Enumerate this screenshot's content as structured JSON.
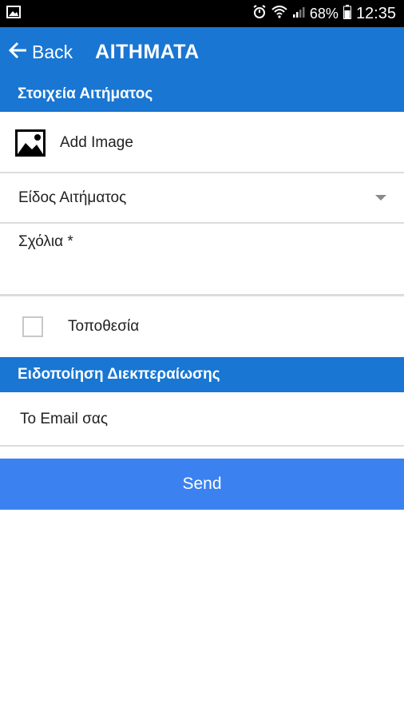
{
  "status_bar": {
    "icons": [
      "image-notification-icon",
      "alarm-icon",
      "wifi-icon",
      "signal-icon",
      "battery-icon"
    ],
    "battery": "68%",
    "time": "12:35"
  },
  "app_bar": {
    "back_label": "Back",
    "title": "ΑΙΤΗΜΑΤΑ",
    "color": "#1976d2"
  },
  "section_request": {
    "title": "Στοιχεία Αιτήματος"
  },
  "add_image": {
    "label": "Add Image",
    "icon": "image-icon"
  },
  "request_type": {
    "selected": "Είδος Αιτήματος"
  },
  "comments": {
    "label": "Σχόλια *",
    "value": ""
  },
  "location": {
    "label": "Τοποθεσία",
    "checked": false
  },
  "section_notification": {
    "title": "Ειδοποίηση Διεκπεραίωσης"
  },
  "email": {
    "placeholder": "Το Email σας",
    "value": ""
  },
  "send_button": {
    "label": "Send",
    "color": "#3b82f0"
  }
}
